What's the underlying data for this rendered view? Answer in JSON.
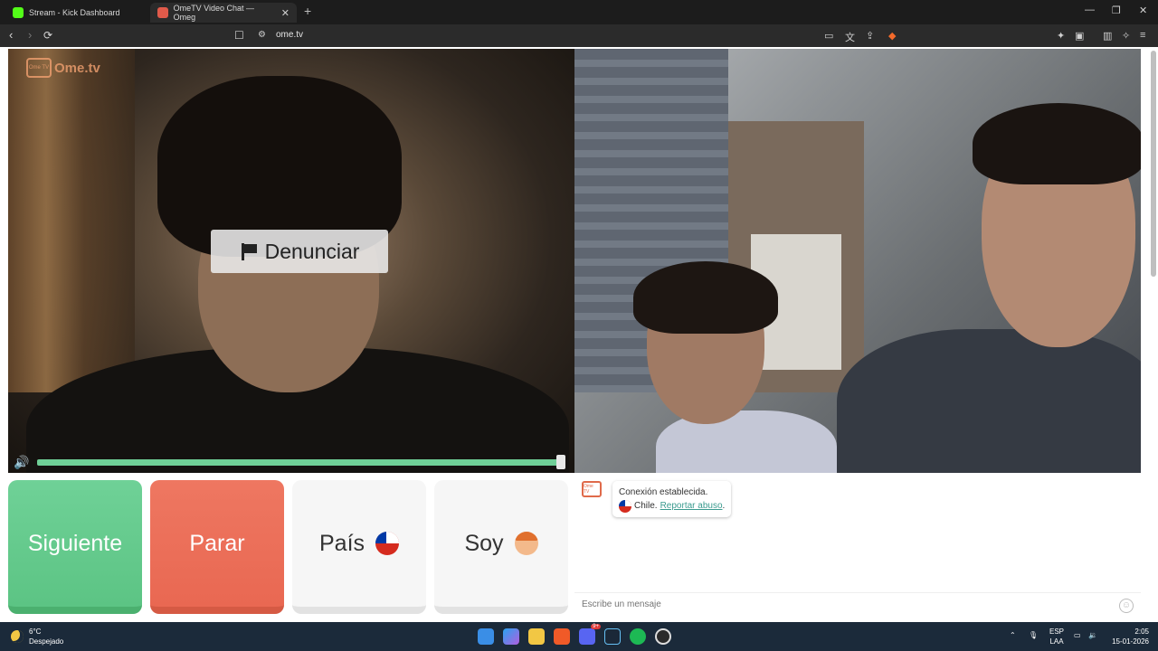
{
  "browser": {
    "tabs": [
      {
        "label": "Stream - Kick Dashboard",
        "active": false
      },
      {
        "label": "OmeTV Video Chat — Omeg",
        "active": true
      }
    ],
    "url": "ome.tv"
  },
  "page": {
    "logo_text": "Ome.tv",
    "logo_box_text": "Ome TV",
    "report_label": "Denunciar",
    "volume_level": 1.0,
    "buttons": {
      "next": "Siguiente",
      "stop": "Parar",
      "country": "País",
      "gender": "Soy"
    },
    "chat": {
      "logo_text": "Ome TV",
      "status": "Conexión establecida.",
      "country": "Chile.",
      "report_link": "Reportar abuso",
      "report_suffix": ".",
      "input_placeholder": "Escribe un mensaje"
    }
  },
  "taskbar": {
    "weather_temp": "6°C",
    "weather_desc": "Despejado",
    "lang_top": "ESP",
    "lang_bottom": "LAA",
    "time": "2:05",
    "date": "15-01-2026",
    "discord_badge": "9+"
  },
  "colors": {
    "next": "#5cc484",
    "stop": "#e96852",
    "accent_link": "#3b9b8f"
  }
}
